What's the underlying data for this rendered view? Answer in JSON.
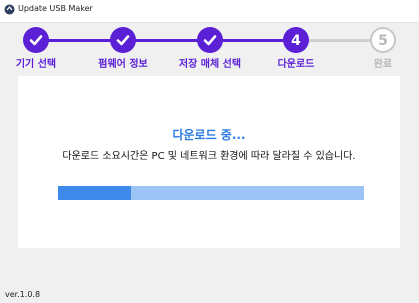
{
  "window": {
    "title": "Update USB Maker"
  },
  "steps": [
    {
      "label": "기기 선택",
      "state": "done",
      "icon": "check-icon"
    },
    {
      "label": "펌웨어 정보",
      "state": "done",
      "icon": "check-icon"
    },
    {
      "label": "저장 매체 선택",
      "state": "done",
      "icon": "check-icon"
    },
    {
      "label": "다운로드",
      "state": "active",
      "number": "4"
    },
    {
      "label": "완료",
      "state": "pending",
      "number": "5"
    }
  ],
  "download": {
    "title": "다운로드 중...",
    "description": "다운로드 소요시간은 PC 및 네트워크 환경에 따라 달라질 수 있습니다.",
    "progress_percent": 24
  },
  "footer": {
    "version": "ver.1.0.8"
  },
  "colors": {
    "step_done": "#5b1fd6",
    "step_pending": "#b8b8b8",
    "title_text": "#2b7be0",
    "progress_fill": "#3f89ea",
    "progress_track": "#9ec3f5"
  }
}
